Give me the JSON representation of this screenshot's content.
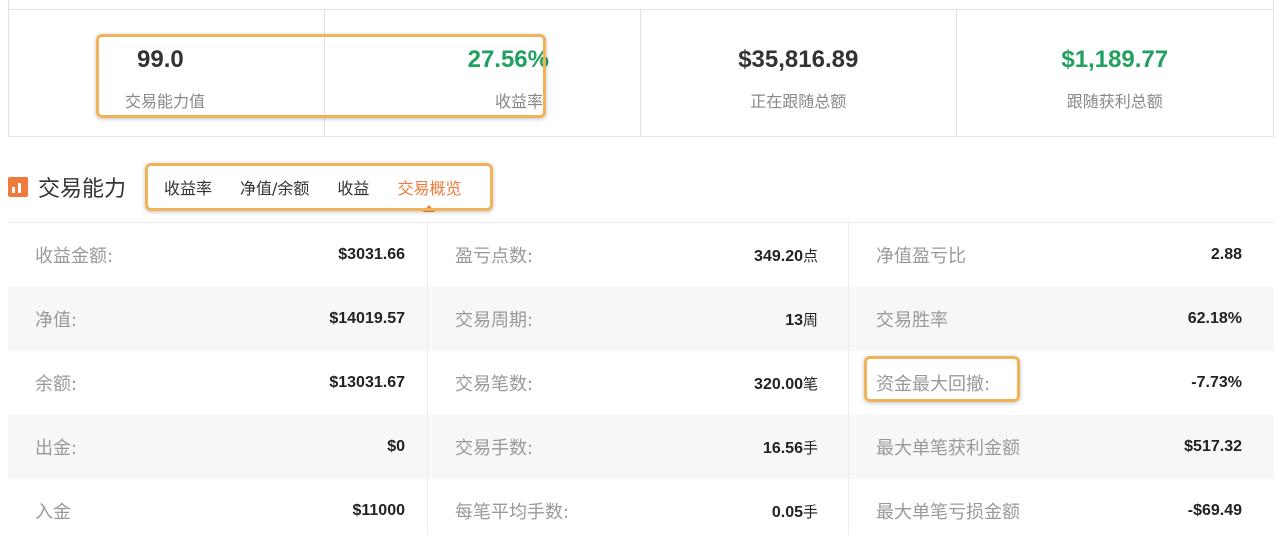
{
  "stats": [
    {
      "value": "99.0",
      "label": "交易能力值"
    },
    {
      "value": "27.56%",
      "label": "收益率"
    },
    {
      "value": "$35,816.89",
      "label": "正在跟随总额"
    },
    {
      "value": "$1,189.77",
      "label": "跟随获利总额"
    }
  ],
  "section": {
    "title": "交易能力",
    "icon": "chart-icon"
  },
  "tabs": [
    {
      "label": "收益率"
    },
    {
      "label": "净值/余额"
    },
    {
      "label": "收益"
    },
    {
      "label": "交易概览",
      "active": true
    }
  ],
  "overview": [
    [
      {
        "label": "收益金额:",
        "value": "$3031.66",
        "unit": ""
      },
      {
        "label": "盈亏点数:",
        "value": "349.20",
        "unit": "点"
      },
      {
        "label": "净值盈亏比",
        "value": "2.88",
        "unit": ""
      }
    ],
    [
      {
        "label": "净值:",
        "value": "$14019.57",
        "unit": ""
      },
      {
        "label": "交易周期:",
        "value": "13",
        "unit": "周"
      },
      {
        "label": "交易胜率",
        "value": "62.18%",
        "unit": ""
      }
    ],
    [
      {
        "label": "余额:",
        "value": "$13031.67",
        "unit": ""
      },
      {
        "label": "交易笔数:",
        "value": "320.00",
        "unit": "笔"
      },
      {
        "label": "资金最大回撤:",
        "value": "-7.73%",
        "unit": ""
      }
    ],
    [
      {
        "label": "出金:",
        "value": "$0",
        "unit": ""
      },
      {
        "label": "交易手数:",
        "value": "16.56",
        "unit": "手"
      },
      {
        "label": "最大单笔获利金额",
        "value": "$517.32",
        "unit": ""
      }
    ],
    [
      {
        "label": "入金",
        "value": "$11000",
        "unit": ""
      },
      {
        "label": "每笔平均手数:",
        "value": "0.05",
        "unit": "手"
      },
      {
        "label": "最大单笔亏损金额",
        "value": "-$69.49",
        "unit": ""
      }
    ]
  ],
  "colors": {
    "accent": "#f07a3a",
    "positive": "#22a060",
    "highlight": "#f0b35a"
  }
}
